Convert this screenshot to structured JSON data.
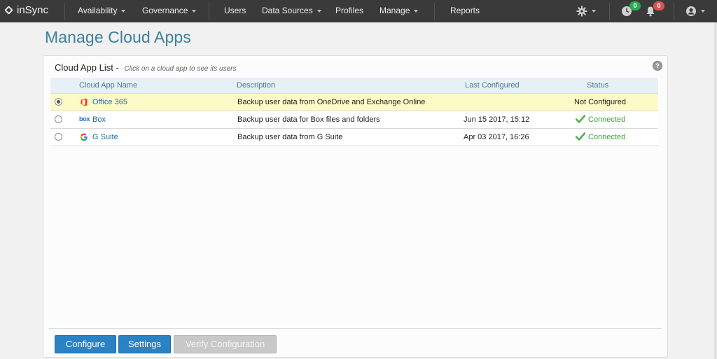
{
  "nav": {
    "logo": "inSync",
    "items": [
      {
        "label": "Availability",
        "dropdown": true
      },
      {
        "label": "Governance",
        "dropdown": true
      },
      {
        "label": "Users",
        "dropdown": false
      },
      {
        "label": "Data Sources",
        "dropdown": true
      },
      {
        "label": "Profiles",
        "dropdown": false
      },
      {
        "label": "Manage",
        "dropdown": true
      },
      {
        "label": "Reports",
        "dropdown": false
      }
    ],
    "icons": {
      "settings": "gear-icon",
      "jobs": "clock-icon",
      "alerts": "bell-icon",
      "user": "user-avatar-icon"
    },
    "jobs_count": "0",
    "alerts_count": "0"
  },
  "page": {
    "title": "Manage Cloud Apps"
  },
  "panel": {
    "title": "Cloud App List -",
    "hint": "Click on a cloud app to see its users",
    "help_label": "?"
  },
  "table": {
    "headers": {
      "name": "Cloud App Name",
      "description": "Description",
      "last_configured": "Last Configured",
      "status": "Status"
    },
    "rows": [
      {
        "name": "Office 365",
        "icon": "office365-icon",
        "description": "Backup user data from OneDrive and Exchange Online",
        "last_configured": "",
        "status": "Not Configured",
        "selected": true
      },
      {
        "name": "Box",
        "icon": "box-icon",
        "icon_text": "box",
        "description": "Backup user data for Box files and folders",
        "last_configured": "Jun 15 2017, 15:12",
        "status": "Connected",
        "selected": false
      },
      {
        "name": "G Suite",
        "icon": "google-icon",
        "description": "Backup user data from G Suite",
        "last_configured": "Apr 03 2017, 16:26",
        "status": "Connected",
        "selected": false
      }
    ]
  },
  "colors": {
    "accent": "#2a82c4",
    "connected": "#3aa63a",
    "selected_row": "#fcfbc7",
    "title": "#3b7fa0"
  },
  "buttons": {
    "configure": "Configure",
    "settings": "Settings",
    "verify": "Verify Configuration"
  }
}
